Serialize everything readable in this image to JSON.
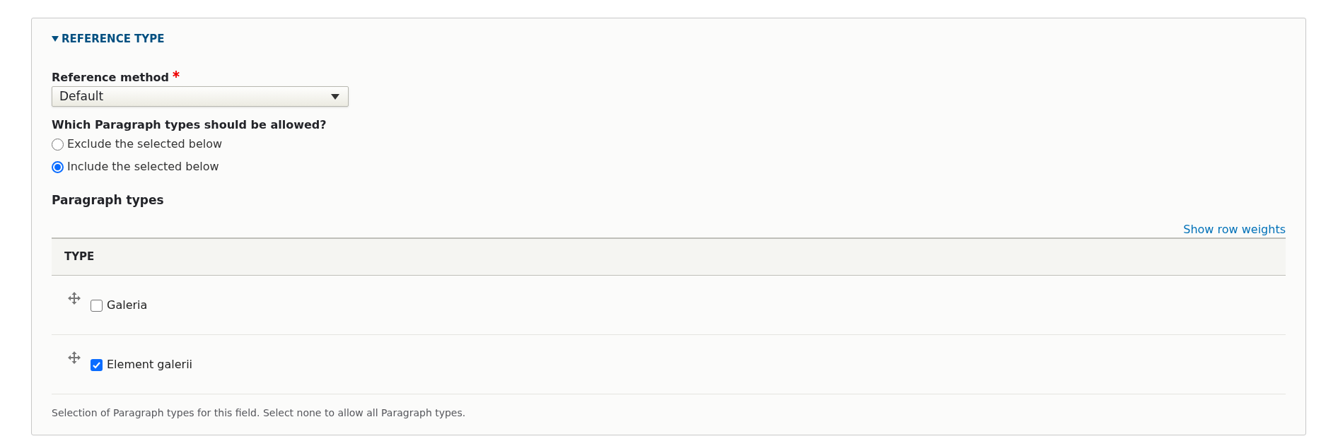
{
  "details": {
    "summary": "REFERENCE TYPE",
    "expanded": true
  },
  "reference_method": {
    "label": "Reference method",
    "required": true,
    "value": "Default"
  },
  "allowed": {
    "question": "Which Paragraph types should be allowed?",
    "options": [
      {
        "label": "Exclude the selected below",
        "selected": false
      },
      {
        "label": "Include the selected below",
        "selected": true
      }
    ]
  },
  "paragraph_types": {
    "title": "Paragraph types",
    "link": "Show row weights",
    "table": {
      "columns": [
        "TYPE"
      ],
      "rows": [
        {
          "label": "Galeria",
          "checked": false
        },
        {
          "label": "Element galerii",
          "checked": true
        }
      ]
    },
    "description": "Selection of Paragraph types for this field. Select none to allow all Paragraph types."
  }
}
